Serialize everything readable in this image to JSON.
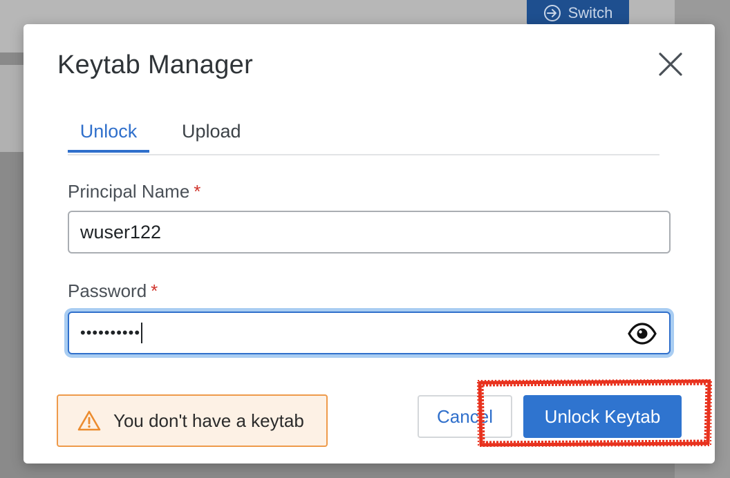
{
  "background": {
    "switch_button_label": "Switch"
  },
  "modal": {
    "title": "Keytab Manager",
    "tabs": [
      {
        "label": "Unlock",
        "active": true
      },
      {
        "label": "Upload",
        "active": false
      }
    ],
    "principal_field": {
      "label": "Principal Name",
      "required_marker": "*",
      "value": "wuser122"
    },
    "password_field": {
      "label": "Password",
      "required_marker": "*",
      "masked_value": "••••••••••"
    },
    "alert": {
      "text": "You don't have a keytab",
      "icon": "warning-triangle-icon"
    },
    "buttons": {
      "cancel_label": "Cancel",
      "primary_label": "Unlock Keytab"
    }
  },
  "colors": {
    "accent": "#2f6fcb",
    "primary_button": "#2f74cf",
    "required": "#d0342c",
    "alert_border": "#ee9a4a",
    "alert_bg": "#fdf1e5",
    "annotation": "#e8321e"
  }
}
